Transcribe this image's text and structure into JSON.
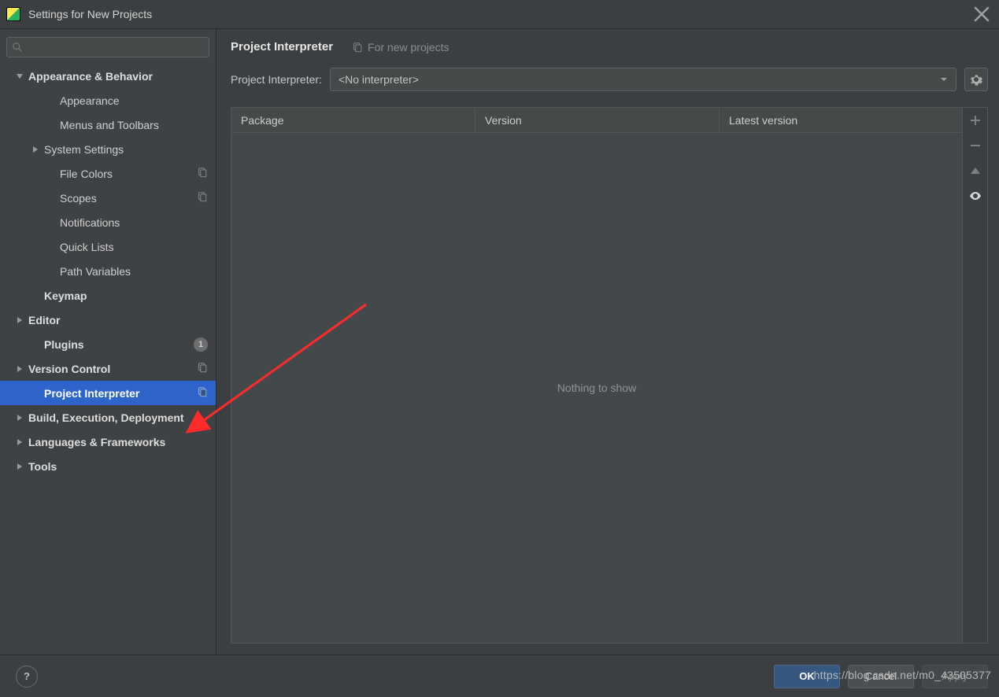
{
  "window": {
    "title": "Settings for New Projects"
  },
  "search": {
    "placeholder": ""
  },
  "sidebar": {
    "items": [
      {
        "label": "Appearance & Behavior",
        "level": 0,
        "bold": true,
        "expand": "down",
        "selected": false,
        "badge": null,
        "copy": false
      },
      {
        "label": "Appearance",
        "level": 2,
        "bold": false,
        "expand": null,
        "selected": false,
        "badge": null,
        "copy": false
      },
      {
        "label": "Menus and Toolbars",
        "level": 2,
        "bold": false,
        "expand": null,
        "selected": false,
        "badge": null,
        "copy": false
      },
      {
        "label": "System Settings",
        "level": 1,
        "bold": false,
        "expand": "right",
        "selected": false,
        "badge": null,
        "copy": false
      },
      {
        "label": "File Colors",
        "level": 2,
        "bold": false,
        "expand": null,
        "selected": false,
        "badge": null,
        "copy": true
      },
      {
        "label": "Scopes",
        "level": 2,
        "bold": false,
        "expand": null,
        "selected": false,
        "badge": null,
        "copy": true
      },
      {
        "label": "Notifications",
        "level": 2,
        "bold": false,
        "expand": null,
        "selected": false,
        "badge": null,
        "copy": false
      },
      {
        "label": "Quick Lists",
        "level": 2,
        "bold": false,
        "expand": null,
        "selected": false,
        "badge": null,
        "copy": false
      },
      {
        "label": "Path Variables",
        "level": 2,
        "bold": false,
        "expand": null,
        "selected": false,
        "badge": null,
        "copy": false
      },
      {
        "label": "Keymap",
        "level": 1,
        "bold": true,
        "expand": null,
        "selected": false,
        "badge": null,
        "copy": false
      },
      {
        "label": "Editor",
        "level": 0,
        "bold": true,
        "expand": "right",
        "selected": false,
        "badge": null,
        "copy": false
      },
      {
        "label": "Plugins",
        "level": 1,
        "bold": true,
        "expand": null,
        "selected": false,
        "badge": "1",
        "copy": false
      },
      {
        "label": "Version Control",
        "level": 0,
        "bold": true,
        "expand": "right",
        "selected": false,
        "badge": null,
        "copy": true
      },
      {
        "label": "Project Interpreter",
        "level": 1,
        "bold": true,
        "expand": null,
        "selected": true,
        "badge": null,
        "copy": true
      },
      {
        "label": "Build, Execution, Deployment",
        "level": 0,
        "bold": true,
        "expand": "right",
        "selected": false,
        "badge": null,
        "copy": false
      },
      {
        "label": "Languages & Frameworks",
        "level": 0,
        "bold": true,
        "expand": "right",
        "selected": false,
        "badge": null,
        "copy": false
      },
      {
        "label": "Tools",
        "level": 0,
        "bold": true,
        "expand": "right",
        "selected": false,
        "badge": null,
        "copy": false
      }
    ]
  },
  "main": {
    "title": "Project Interpreter",
    "subtitle": "For new projects",
    "interpreter_label": "Project Interpreter:",
    "interpreter_value": "<No interpreter>",
    "columns": {
      "c1": "Package",
      "c2": "Version",
      "c3": "Latest version"
    },
    "empty_text": "Nothing to show"
  },
  "footer": {
    "ok": "OK",
    "cancel": "Cancel",
    "apply": "Apply"
  },
  "watermark": "https://blog.csdn.net/m0_43505377"
}
